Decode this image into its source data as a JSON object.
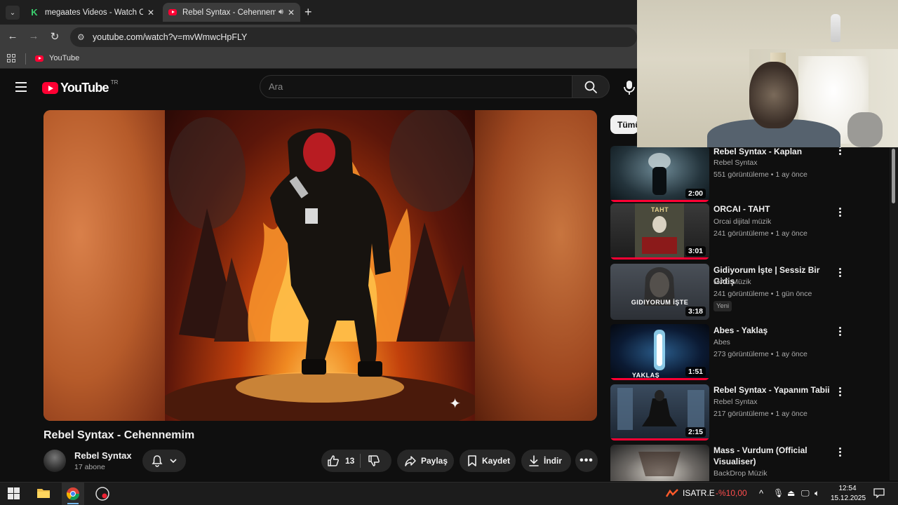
{
  "browser": {
    "tabs": [
      {
        "title": "megaates Videos - Watch On-D",
        "favicon": "k-logo-icon"
      },
      {
        "title": "Rebel Syntax - Cehennemim",
        "favicon": "youtube-icon",
        "audio": true
      }
    ],
    "url": "youtube.com/watch?v=mvWmwcHpFLY",
    "bookmarks": [
      {
        "label": "YouTube"
      }
    ]
  },
  "youtube": {
    "logo_text": "YouTube",
    "country_code": "TR",
    "search_placeholder": "Ara"
  },
  "video": {
    "title": "Rebel Syntax - Cehennemim",
    "channel": "Rebel Syntax",
    "subscribers": "17 abone",
    "likes": "13",
    "share_label": "Paylaş",
    "save_label": "Kaydet",
    "download_label": "İndir"
  },
  "sidebar": {
    "chip_label": "Tümü",
    "items": [
      {
        "title": "Rebel Syntax - Kaplan",
        "channel": "Rebel Syntax",
        "meta": "551 görüntüleme • 1 ay önce",
        "duration": "2:00",
        "progress": 1.0
      },
      {
        "title": "ORCAI - TAHT",
        "channel": "Orcai dijital müzik",
        "meta": "241 görüntüleme • 1 ay önce",
        "duration": "3:01",
        "thumb_label": "TAHT",
        "progress": 1.0
      },
      {
        "title": "Gidiyorum İşte | Sessiz Bir Gidiş",
        "channel": "MAD Müzik",
        "meta": "241 görüntüleme • 1 gün önce",
        "badge": "Yeni",
        "duration": "3:18",
        "thumb_label": "GIDIYORUM İŞTE",
        "progress": 0
      },
      {
        "title": "Abes - Yaklaş",
        "channel": "Abes",
        "meta": "273 görüntüleme • 1 ay önce",
        "duration": "1:51",
        "thumb_label": "YAKLAŞ",
        "progress": 1.0
      },
      {
        "title": "Rebel Syntax - Yapanım Tabii",
        "channel": "Rebel Syntax",
        "meta": "217 görüntüleme • 1 ay önce",
        "duration": "2:15",
        "progress": 1.0
      },
      {
        "title": "Mass - Vurdum (Official Visualiser)",
        "channel": "BackDrop Müzik",
        "meta": "",
        "duration": "",
        "progress": 0
      }
    ]
  },
  "taskbar": {
    "stock_symbol": "ISATR.E",
    "stock_change": "-%10,00",
    "time": "12:54",
    "date": "15.12.2025"
  },
  "colors": {
    "youtube_red": "#ff0033",
    "background": "#0f0f0f",
    "stock_negative": "#ff4d4d"
  }
}
